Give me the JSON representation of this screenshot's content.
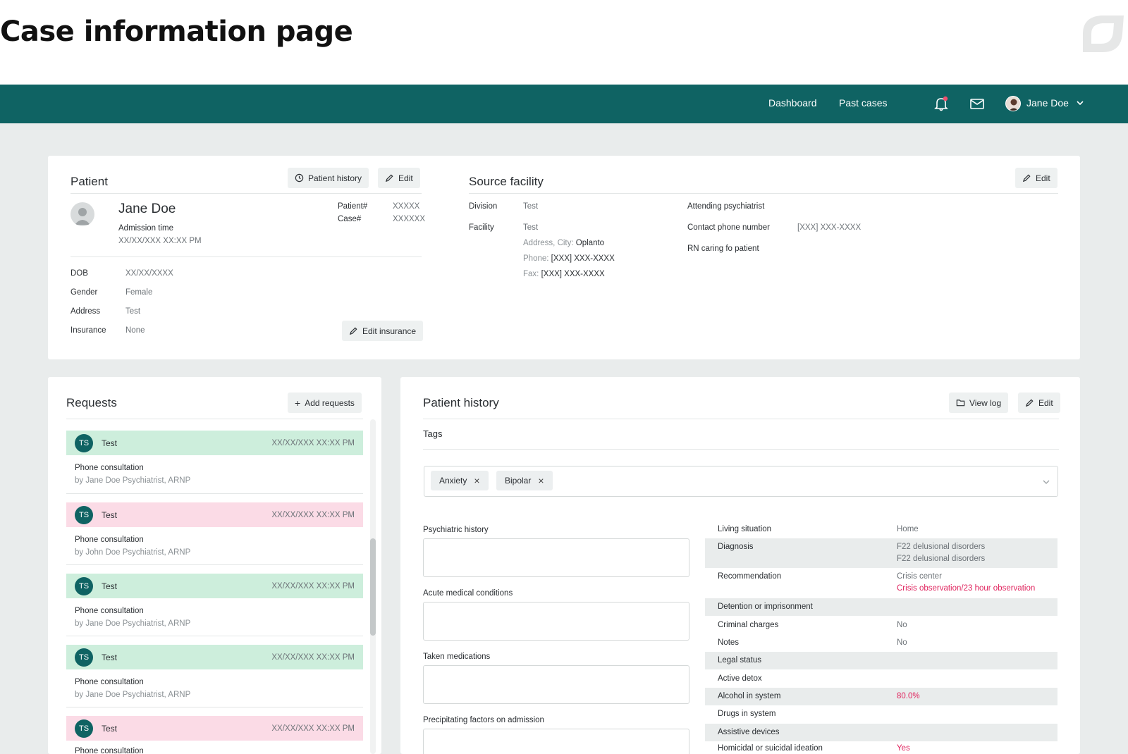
{
  "page": {
    "title": "Case information page"
  },
  "nav": {
    "dashboard": "Dashboard",
    "past_cases": "Past cases",
    "user_name": "Jane Doe",
    "accent": "#0f6363"
  },
  "patient": {
    "title": "Patient",
    "history_button": "Patient history",
    "edit_button": "Edit",
    "name": "Jane Doe",
    "admission_label": "Admission time",
    "admission_value": "XX/XX/XXX XX:XX PM",
    "patient_no_label": "Patient#",
    "patient_no_value": "XXXXX",
    "case_no_label": "Case#",
    "case_no_value": "XXXXXX",
    "dob_label": "DOB",
    "dob_value": "XX/XX/XXXX",
    "gender_label": "Gender",
    "gender_value": "Female",
    "address_label": "Address",
    "address_value": "Test",
    "insurance_label": "Insurance",
    "insurance_value": "None",
    "edit_insurance_button": "Edit insurance"
  },
  "source": {
    "title": "Source facility",
    "edit_button": "Edit",
    "division_label": "Division",
    "division_value": "Test",
    "facility_label": "Facility",
    "facility_value": "Test",
    "address_prefix": "Address, City:",
    "address_value": "Oplanto",
    "phone_prefix": "Phone:",
    "phone_value": "[XXX] XXX-XXXX",
    "fax_prefix": "Fax:",
    "fax_value": "[XXX] XXX-XXXX",
    "attending_label": "Attending psychiatrist",
    "contact_label": "Contact phone number",
    "contact_value": "[XXX] XXX-XXXX",
    "rn_label": "RN caring fo patient"
  },
  "requests": {
    "title": "Requests",
    "add_button": "Add requests",
    "items": [
      {
        "initials": "TS",
        "name": "Test",
        "time": "XX/XX/XXX XX:XX PM",
        "type": "Phone consultation",
        "by": "by Jane Doe Psychiatrist, ARNP",
        "status": "green"
      },
      {
        "initials": "TS",
        "name": "Test",
        "time": "XX/XX/XXX XX:XX PM",
        "type": "Phone consultation",
        "by": "by John Doe Psychiatrist, ARNP",
        "status": "pink"
      },
      {
        "initials": "TS",
        "name": "Test",
        "time": "XX/XX/XXX XX:XX PM",
        "type": "Phone consultation",
        "by": "by Jane Doe Psychiatrist, ARNP",
        "status": "green"
      },
      {
        "initials": "TS",
        "name": "Test",
        "time": "XX/XX/XXX XX:XX PM",
        "type": "Phone consultation",
        "by": "by Jane Doe Psychiatrist, ARNP",
        "status": "green"
      },
      {
        "initials": "TS",
        "name": "Test",
        "time": "XX/XX/XXX XX:XX PM",
        "type": "Phone consultation",
        "by": "",
        "status": "pink"
      }
    ]
  },
  "history": {
    "title": "Patient history",
    "view_log_button": "View log",
    "edit_button": "Edit",
    "tags_label": "Tags",
    "tags": [
      "Anxiety",
      "Bipolar"
    ],
    "fields": [
      {
        "label": "Psychiatric history",
        "value": ""
      },
      {
        "label": "Acute medical conditions",
        "value": ""
      },
      {
        "label": "Taken medications",
        "value": ""
      },
      {
        "label": "Precipitating factors on admission",
        "value": ""
      }
    ],
    "info": {
      "living_label": "Living situation",
      "living_value": "Home",
      "diagnosis_label": "Diagnosis",
      "diagnosis_value_1": "F22 delusional disorders",
      "diagnosis_value_2": "F22 delusional disorders",
      "recommendation_label": "Recommendation",
      "recommendation_value_1": "Crisis center",
      "recommendation_value_2": "Crisis observation/23 hour observation",
      "detention_label": "Detention or imprisonment",
      "criminal_label": "Criminal charges",
      "criminal_value": "No",
      "notes_label": "Notes",
      "notes_value": "No",
      "legal_label": "Legal status",
      "detox_label": "Active detox",
      "alcohol_label": "Alcohol in system",
      "alcohol_value": "80.0%",
      "drugs_label": "Drugs in system",
      "assistive_label": "Assistive devices",
      "homicidal_label": "Homicidal or suicidal ideation",
      "homicidal_value": "Yes"
    },
    "highlight_color": "#e0245e"
  }
}
